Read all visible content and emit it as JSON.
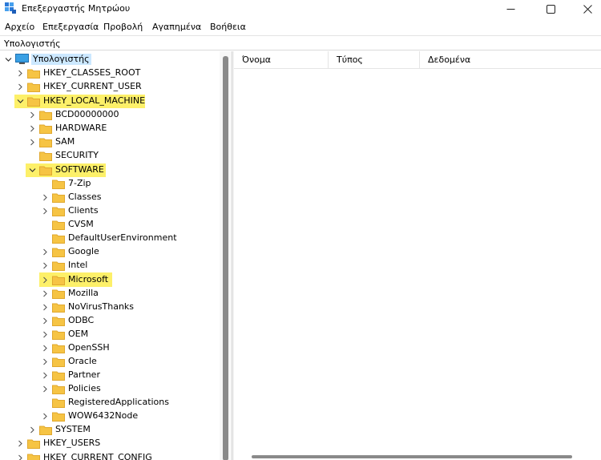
{
  "window": {
    "title": "Επεξεργαστής Μητρώου"
  },
  "menu": [
    "Αρχείο",
    "Επεξεργασία",
    "Προβολή",
    "Αγαπημένα",
    "Βοήθεια"
  ],
  "address": "Υπολογιστής",
  "tree": {
    "root": "Υπολογιστής",
    "hives": {
      "classes_root": "HKEY_CLASSES_ROOT",
      "current_user": "HKEY_CURRENT_USER",
      "local_machine": "HKEY_LOCAL_MACHINE",
      "users": "HKEY_USERS",
      "current_config": "HKEY_CURRENT_CONFIG"
    },
    "hklm_children": {
      "bcd": "BCD00000000",
      "hardware": "HARDWARE",
      "sam": "SAM",
      "security": "SECURITY",
      "software": "SOFTWARE",
      "system": "SYSTEM"
    },
    "software_children": {
      "zip": "7-Zip",
      "classes": "Classes",
      "clients": "Clients",
      "cvsm": "CVSM",
      "defaultuserenv": "DefaultUserEnvironment",
      "google": "Google",
      "intel": "Intel",
      "microsoft": "Microsoft",
      "mozilla": "Mozilla",
      "novirusthanks": "NoVirusThanks",
      "odbc": "ODBC",
      "oem": "OEM",
      "openssh": "OpenSSH",
      "oracle": "Oracle",
      "partner": "Partner",
      "policies": "Policies",
      "registeredapps": "RegisteredApplications",
      "wow6432": "WOW6432Node"
    }
  },
  "list": {
    "columns": {
      "name": "Όνομα",
      "type": "Τύπος",
      "data": "Δεδομένα"
    }
  },
  "colors": {
    "highlight": "#fdf069",
    "folder": "#f6c444",
    "folder_dark": "#e0a82e",
    "selection": "#cce8ff"
  }
}
